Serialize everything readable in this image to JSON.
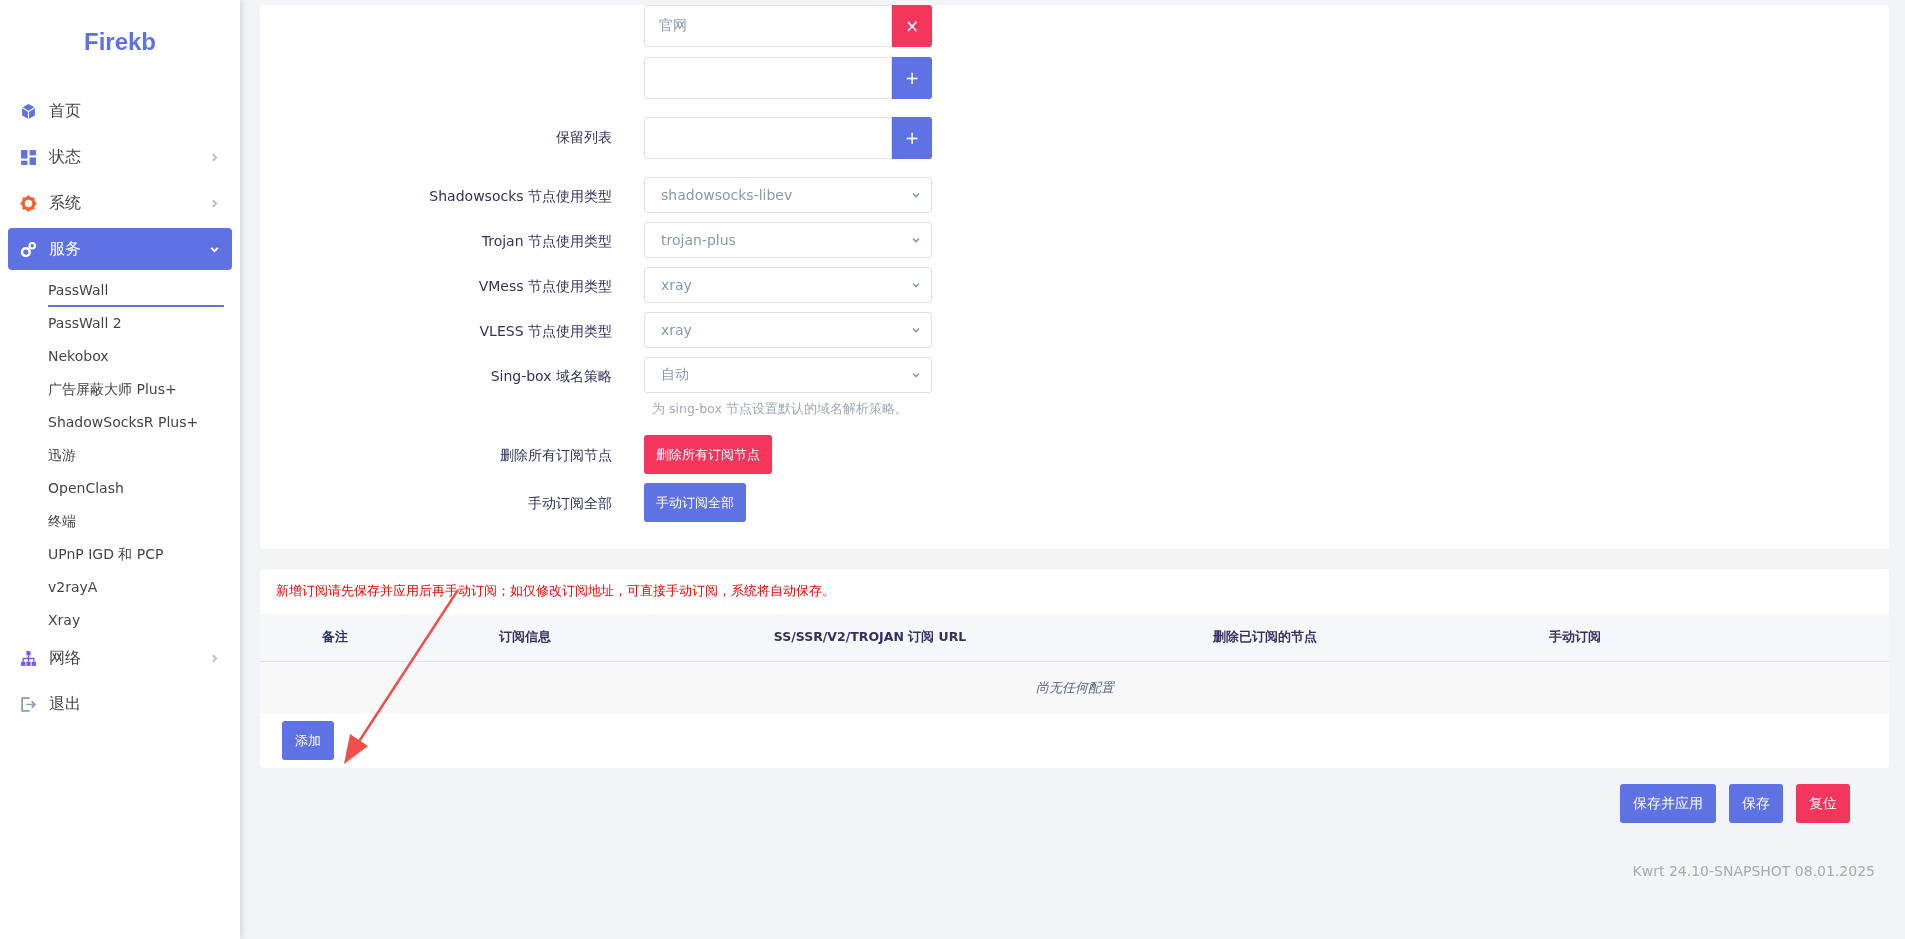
{
  "sidebar": {
    "logo": "Firekb",
    "items": [
      {
        "label": "首页",
        "selected": false
      },
      {
        "label": "状态",
        "expanded": false,
        "selected": false
      },
      {
        "label": "系统",
        "expanded": false,
        "selected": false
      },
      {
        "label": "服务",
        "expanded": true,
        "selected": true,
        "children": [
          {
            "label": "PassWall",
            "selected": true
          },
          {
            "label": "PassWall 2",
            "selected": false
          },
          {
            "label": "Nekobox",
            "selected": false
          },
          {
            "label": "广告屏蔽大师 Plus+",
            "selected": false
          },
          {
            "label": "ShadowSocksR Plus+",
            "selected": false
          },
          {
            "label": "迅游",
            "selected": false
          },
          {
            "label": "OpenClash",
            "selected": false
          },
          {
            "label": "终端",
            "selected": false
          },
          {
            "label": "UPnP IGD 和 PCP",
            "selected": false
          },
          {
            "label": "v2rayA",
            "selected": false
          },
          {
            "label": "Xray",
            "selected": false
          }
        ]
      },
      {
        "label": "网络",
        "expanded": false,
        "selected": false
      },
      {
        "label": "退出",
        "selected": false
      }
    ]
  },
  "form": [
    {
      "kind": "list",
      "entries": [
        {
          "value": "官网",
          "button": "×",
          "color": "#f5365c"
        },
        {
          "button": "+",
          "color": "#5e72e4"
        }
      ]
    },
    {
      "kind": "list",
      "label": "保留列表",
      "entries": [
        {
          "button": "+",
          "color": "#5e72e4"
        }
      ]
    },
    {
      "kind": "select",
      "label": "Shadowsocks 节点使用类型",
      "value": "shadowsocks-libev"
    },
    {
      "kind": "select",
      "label": "Trojan 节点使用类型",
      "value": "trojan-plus"
    },
    {
      "kind": "select",
      "label": "VMess 节点使用类型",
      "value": "xray"
    },
    {
      "kind": "select",
      "label": "VLESS 节点使用类型",
      "value": "xray"
    },
    {
      "kind": "select",
      "label": "Sing-box 域名策略",
      "value": "自动",
      "hint": "为 sing-box 节点设置默认的域名解析策略。"
    },
    {
      "kind": "button",
      "label": "删除所有订阅节点",
      "button": "删除所有订阅节点",
      "color": "#f5365c"
    },
    {
      "kind": "button",
      "label": "手动订阅全部",
      "button": "手动订阅全部",
      "color": "#5e72e4"
    }
  ],
  "subscriptions": {
    "notice": "新增订阅请先保存并应用后再手动订阅；如仅修改订阅地址，可直接手动订阅，系统将自动保存。",
    "columns": [
      "备注",
      "订阅信息",
      "SS/SSR/V2/TROJAN 订阅 URL",
      "删除已订阅的节点",
      "手动订阅"
    ],
    "empty_text": "尚无任何配置",
    "add_button": "添加"
  },
  "actions": [
    {
      "label": "保存并应用",
      "color": "#5e72e4"
    },
    {
      "label": "保存",
      "color": "#5e72e4"
    },
    {
      "label": "复位",
      "color": "#f5365c"
    }
  ],
  "footer": "Kwrt 24.10-SNAPSHOT 08.01.2025"
}
